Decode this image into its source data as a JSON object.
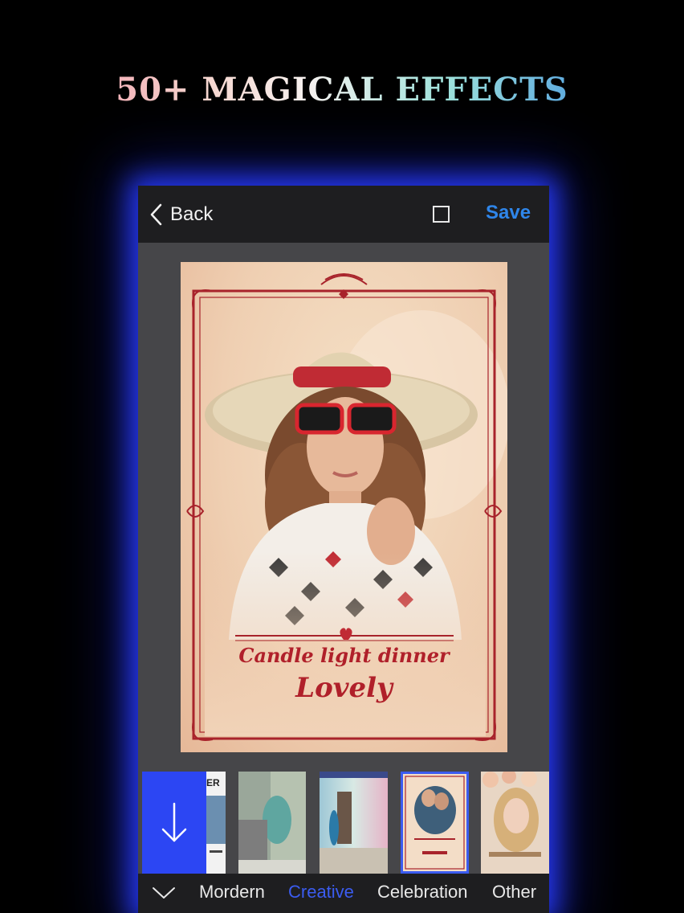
{
  "headline": "50+ MAGICAL EFFECTS",
  "topbar": {
    "back_label": "Back",
    "save_label": "Save"
  },
  "poster": {
    "line1": "Candle light dinner",
    "line2": "Lovely"
  },
  "thumbnails": [
    {
      "name": "party-poster-thumbnail",
      "text": "ER",
      "selected": false
    },
    {
      "name": "vintage-collage-thumbnail",
      "selected": false
    },
    {
      "name": "surfer-thumbnail",
      "selected": false
    },
    {
      "name": "candle-dinner-thumbnail",
      "selected": true
    },
    {
      "name": "creative-floral-thumbnail",
      "selected": false
    }
  ],
  "tabs": [
    {
      "label": "Mordern",
      "active": false
    },
    {
      "label": "Creative",
      "active": true
    },
    {
      "label": "Celebration",
      "active": false
    },
    {
      "label": "Other",
      "active": false
    }
  ],
  "colors": {
    "accent_blue": "#2f86ea",
    "active_tab": "#3b5cf0",
    "glow": "#2836ff",
    "poster_red": "#b0202a"
  },
  "icons": [
    "chevron-left-icon",
    "square-icon",
    "arrow-down-icon",
    "chevron-down-icon"
  ]
}
